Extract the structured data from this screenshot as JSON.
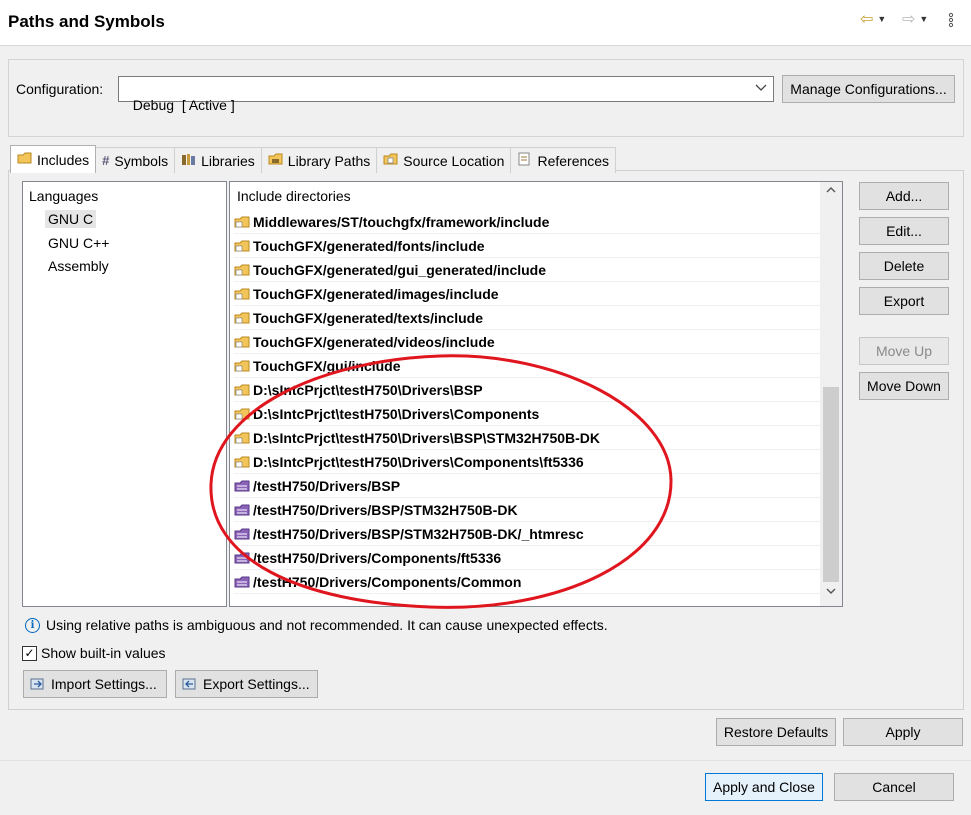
{
  "header": {
    "title": "Paths and Symbols",
    "back_icon": "back-arrow-icon",
    "forward_icon": "forward-arrow-icon"
  },
  "configuration": {
    "label": "Configuration:",
    "value": "Debug  [ Active ]",
    "manage_label": "Manage Configurations..."
  },
  "tabs": [
    {
      "label": "Includes",
      "icon": "includes-icon",
      "active": true
    },
    {
      "label": "Symbols",
      "icon": "hash-icon",
      "active": false
    },
    {
      "label": "Libraries",
      "icon": "libraries-icon",
      "active": false
    },
    {
      "label": "Library Paths",
      "icon": "library-paths-icon",
      "active": false
    },
    {
      "label": "Source Location",
      "icon": "source-location-icon",
      "active": false
    },
    {
      "label": "References",
      "icon": "references-icon",
      "active": false
    }
  ],
  "languages": {
    "title": "Languages",
    "items": [
      "GNU C",
      "GNU C++",
      "Assembly"
    ],
    "selected": "GNU C"
  },
  "includes": {
    "header": "Include directories",
    "rows": [
      {
        "path": "Middlewares/ST/touchgfx/framework/include",
        "kind": "file"
      },
      {
        "path": "TouchGFX/generated/fonts/include",
        "kind": "file"
      },
      {
        "path": "TouchGFX/generated/gui_generated/include",
        "kind": "file"
      },
      {
        "path": "TouchGFX/generated/images/include",
        "kind": "file"
      },
      {
        "path": "TouchGFX/generated/texts/include",
        "kind": "file"
      },
      {
        "path": "TouchGFX/generated/videos/include",
        "kind": "file"
      },
      {
        "path": "TouchGFX/gui/include",
        "kind": "file"
      },
      {
        "path": "D:\\sIntcPrjct\\testH750\\Drivers\\BSP",
        "kind": "file"
      },
      {
        "path": "D:\\sIntcPrjct\\testH750\\Drivers\\Components",
        "kind": "file"
      },
      {
        "path": "D:\\sIntcPrjct\\testH750\\Drivers\\BSP\\STM32H750B-DK",
        "kind": "file"
      },
      {
        "path": "D:\\sIntcPrjct\\testH750\\Drivers\\Components\\ft5336",
        "kind": "file"
      },
      {
        "path": "/testH750/Drivers/BSP",
        "kind": "workspace"
      },
      {
        "path": "/testH750/Drivers/BSP/STM32H750B-DK",
        "kind": "workspace"
      },
      {
        "path": "/testH750/Drivers/BSP/STM32H750B-DK/_htmresc",
        "kind": "workspace"
      },
      {
        "path": "/testH750/Drivers/Components/ft5336",
        "kind": "workspace"
      },
      {
        "path": "/testH750/Drivers/Components/Common",
        "kind": "workspace"
      }
    ]
  },
  "side_buttons": {
    "add": "Add...",
    "edit": "Edit...",
    "delete": "Delete",
    "export": "Export",
    "move_up": "Move Up",
    "move_down": "Move Down"
  },
  "info_text": "Using relative paths is ambiguous and not recommended. It can cause unexpected effects.",
  "show_builtin": {
    "label": "Show built-in values",
    "checked": true
  },
  "import_settings": "Import Settings...",
  "export_settings": "Export Settings...",
  "restore_defaults": "Restore Defaults",
  "apply": "Apply",
  "apply_close": "Apply and Close",
  "cancel": "Cancel",
  "colors": {
    "folder": "#f3c45a",
    "workspace_folder": "#8a63b8",
    "annotation": "#e0161e",
    "accent": "#0078d7"
  }
}
